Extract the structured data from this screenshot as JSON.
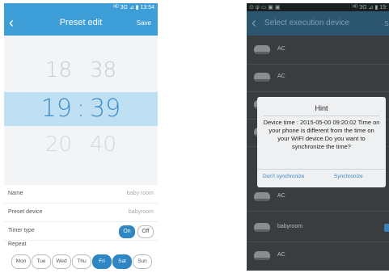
{
  "left_screen": {
    "status_bar": {
      "text": "ᴴᴰ 3G ⊿ ▮ 13:54"
    },
    "header": {
      "back_icon": "‹",
      "title": "Preset edit",
      "save_label": "Save"
    },
    "time_picker": {
      "above": {
        "hour": "18",
        "minute": "38"
      },
      "selected": {
        "hour": "19",
        "separator": ":",
        "minute": "39"
      },
      "below": {
        "hour": "20",
        "minute": "40"
      }
    },
    "form": {
      "name": {
        "label": "Name",
        "value": "baby room"
      },
      "preset_device": {
        "label": "Preset device",
        "value": "babyroom"
      },
      "timer_type": {
        "label": "Timer type",
        "on_label": "On",
        "off_label": "Off",
        "selected": "On"
      },
      "repeat": {
        "label": "Repeat",
        "days": [
          {
            "label": "Mon",
            "selected": false
          },
          {
            "label": "Tue",
            "selected": false
          },
          {
            "label": "Wed",
            "selected": false
          },
          {
            "label": "Thu",
            "selected": false
          },
          {
            "label": "Fri",
            "selected": true
          },
          {
            "label": "Sat",
            "selected": true
          },
          {
            "label": "Sun",
            "selected": false
          }
        ]
      }
    },
    "colors": {
      "accent": "#3d9dd6",
      "picker_highlight": "#bfe0f3",
      "selected_button": "#2f86c4"
    }
  },
  "right_screen": {
    "status_bar": {
      "left_icons": "⊙ ψ ▭ ▣ ▣",
      "right_text": "ᴴᴰ 3G ⊿ ▮ 19:"
    },
    "header": {
      "back_icon": "‹",
      "title": "Select execution device",
      "save_label": "Sa"
    },
    "devices": [
      {
        "name": "AC",
        "icon": "ac-unit-icon"
      },
      {
        "name": "AC",
        "icon": "ac-unit-icon"
      },
      {
        "name": "AC",
        "icon": "ac-unit-icon"
      },
      {
        "name": "AC",
        "icon": "ac-unit-icon"
      },
      {
        "name": "AC",
        "icon": "ac-unit-icon"
      },
      {
        "name": "babyroom",
        "icon": "ac-unit-icon",
        "checked": true
      },
      {
        "name": "AC",
        "icon": "ac-unit-icon"
      }
    ],
    "dialog": {
      "title": "Hint",
      "message": "Device time : 2015-05-00 09:20:02 Time on your phone is different from the time on your WIFI device.Do you want to synchronize the time?",
      "cancel_label": "Don't synchronize",
      "confirm_label": "Synchronize"
    },
    "colors": {
      "overlay": "#3a3d40",
      "header": "#2c5570",
      "dialog_bg": "#eef0f2",
      "dialog_button": "#3b86c6"
    }
  }
}
